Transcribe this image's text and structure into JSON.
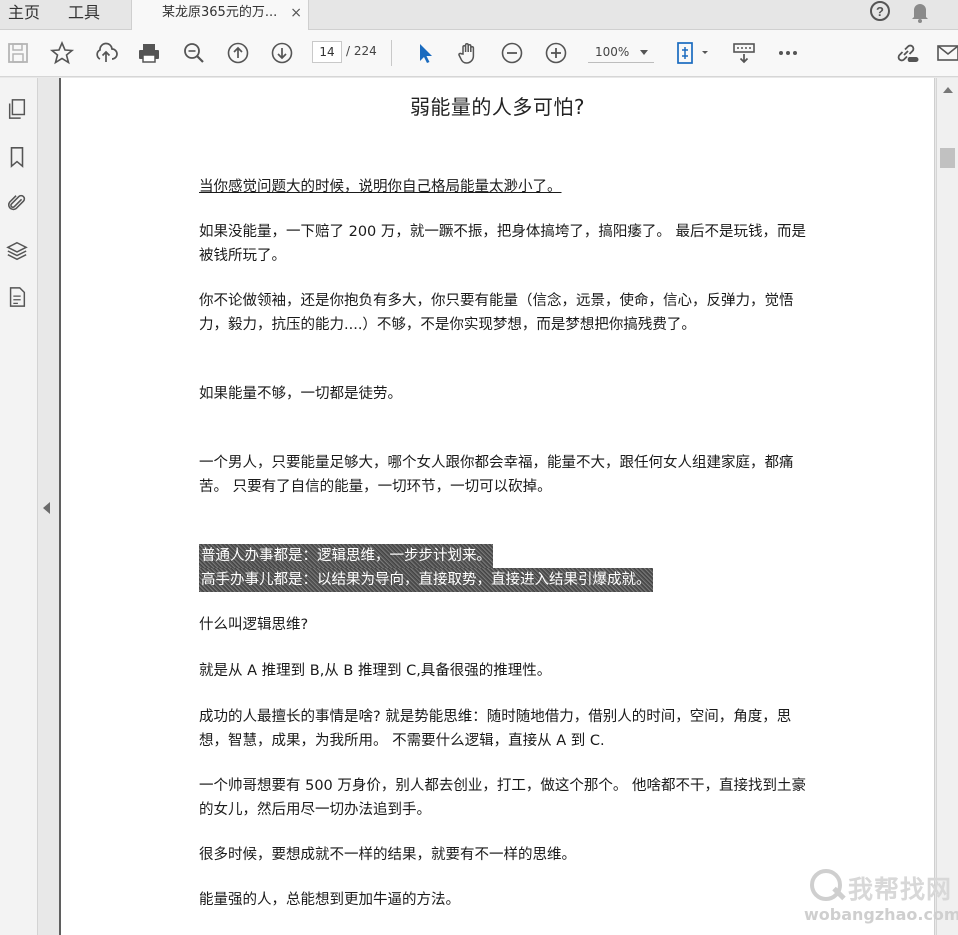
{
  "tabs": {
    "home": "主页",
    "tools": "工具",
    "document": "某龙原365元的万...",
    "close": "×"
  },
  "toolbar": {
    "page_current": "14",
    "page_total": "/ 224",
    "zoom": "100%"
  },
  "document": {
    "title": "弱能量的人多可怕?",
    "paragraphs": [
      "当你感觉问题大的时候，说明你自己格局能量太渺小了。",
      "如果没能量，一下赔了 200 万，就一蹶不振，把身体搞垮了，搞阳痿了。   最后不是玩钱，而是被钱所玩了。",
      "你不论做领袖，还是你抱负有多大，你只要有能量（信念，远景，使命，信心，反弹力，觉悟力，毅力，抗压的能力....）不够，不是你实现梦想，而是梦想把你搞残费了。",
      "如果能量不够，一切都是徒劳。",
      "一个男人，只要能量足够大，哪个女人跟你都会幸福，能量不大，跟任何女人组建家庭，都痛苦。    只要有了自信的能量，一切环节，一切可以砍掉。",
      "普通人办事都是：逻辑思维，一步步计划来。",
      "高手办事儿都是：以结果为导向，直接取势，直接进入结果引爆成就。",
      "什么叫逻辑思维?",
      "就是从 A 推理到 B,从 B 推理到 C,具备很强的推理性。",
      "成功的人最擅长的事情是啥?      就是势能思维：随时随地借力，借别人的时间，空间，角度，思想，智慧，成果，为我所用。 不需要什么逻辑，直接从 A 到 C.",
      "一个帅哥想要有 500 万身价，别人都去创业，打工，做这个那个。 他啥都不干，直接找到土豪的女儿，然后用尽一切办法追到手。",
      "很多时候，要想成就不一样的结果，就要有不一样的思维。",
      "能量强的人，总能想到更加牛逼的方法。"
    ]
  },
  "watermark": {
    "cn": "我帮找网",
    "url": "wobangzhao.com"
  },
  "icons": [
    "help-icon",
    "bell-icon",
    "save-icon",
    "star-icon",
    "upload-icon",
    "print-icon",
    "search-icon",
    "page-up-icon",
    "page-down-icon",
    "select-cursor-icon",
    "hand-icon",
    "zoom-out-icon",
    "zoom-in-icon",
    "fit-page-icon",
    "keyboard-icon",
    "more-icon",
    "link-icon",
    "mail-icon",
    "pages-icon",
    "bookmark-icon",
    "attachment-icon",
    "layers-icon",
    "document-icon"
  ]
}
